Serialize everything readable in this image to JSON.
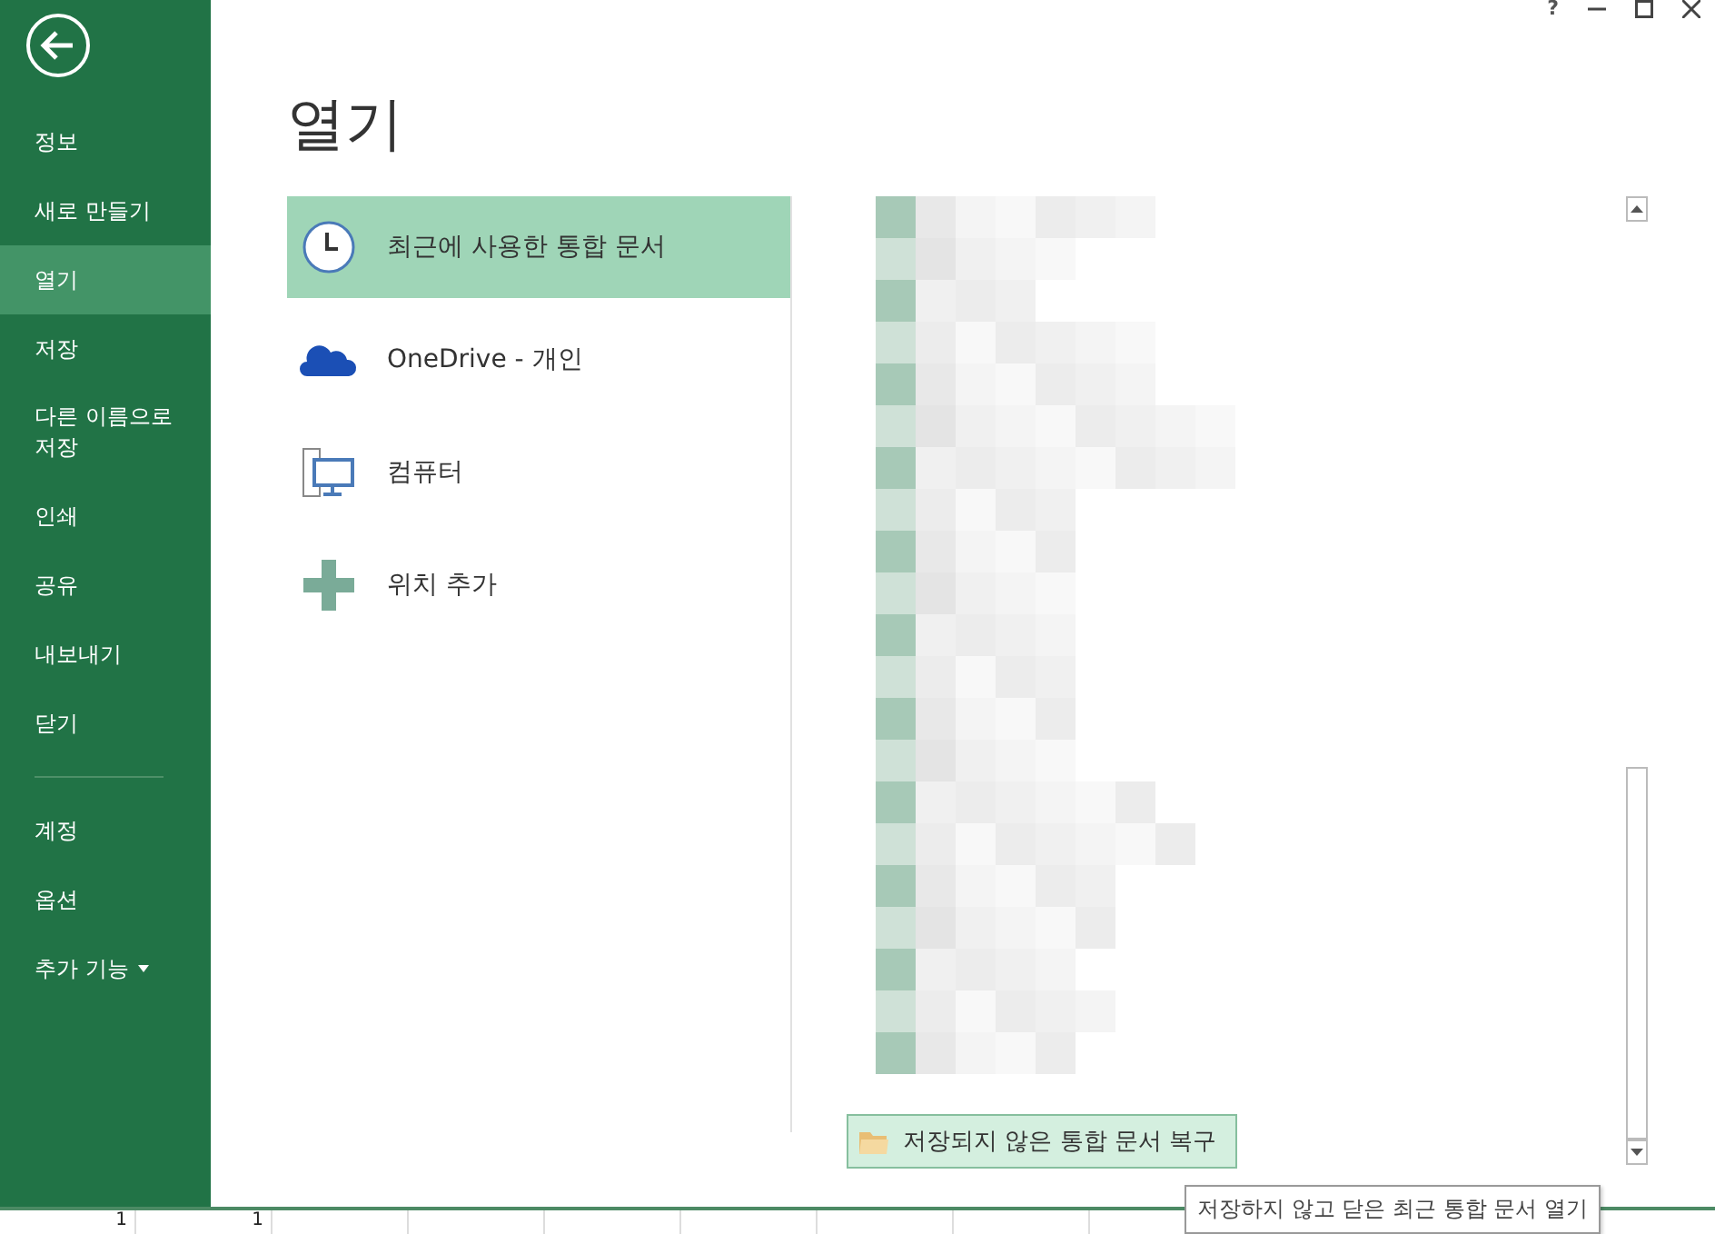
{
  "window_controls": {
    "help": "?"
  },
  "sidebar": {
    "items": [
      {
        "label": "정보",
        "selected": false
      },
      {
        "label": "새로 만들기",
        "selected": false
      },
      {
        "label": "열기",
        "selected": true
      },
      {
        "label": "저장",
        "selected": false
      },
      {
        "label": "다른 이름으로 저장",
        "selected": false
      },
      {
        "label": "인쇄",
        "selected": false
      },
      {
        "label": "공유",
        "selected": false
      },
      {
        "label": "내보내기",
        "selected": false
      },
      {
        "label": "닫기",
        "selected": false
      }
    ],
    "footer_items": [
      {
        "label": "계정",
        "selected": false
      },
      {
        "label": "옵션",
        "selected": false
      },
      {
        "label": "추가 기능",
        "selected": false,
        "dropdown": true
      }
    ]
  },
  "heading": "열기",
  "places": [
    {
      "kind": "recent",
      "label": "최근에 사용한 통합 문서",
      "selected": true
    },
    {
      "kind": "cloud",
      "label": "OneDrive - 개인",
      "selected": false
    },
    {
      "kind": "computer",
      "label": "컴퓨터",
      "selected": false
    },
    {
      "kind": "add",
      "label": "위치 추가",
      "selected": false
    }
  ],
  "recover_button": "저장되지 않은 통합 문서 복구",
  "tooltip": "저장하지 않고 닫은 최근 통합 문서 열기",
  "sheet_row": [
    "1",
    "1"
  ]
}
